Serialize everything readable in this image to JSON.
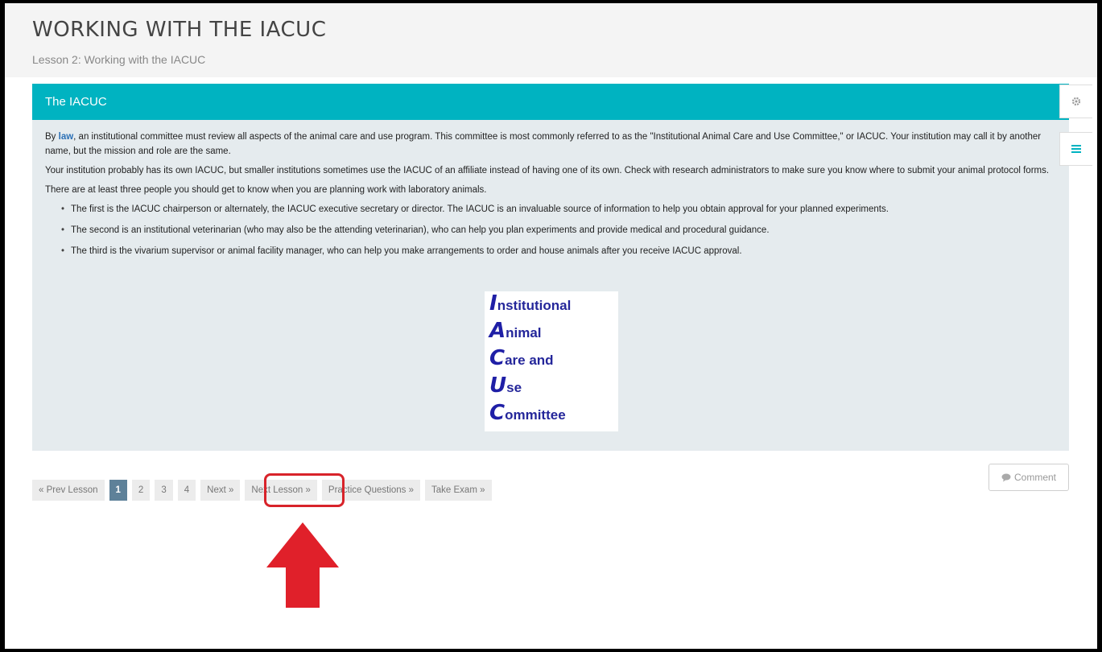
{
  "header": {
    "title": "WORKING WITH THE IACUC",
    "subtitle": "Lesson 2: Working with the IACUC"
  },
  "panel": {
    "title": "The IACUC",
    "paragraph1": {
      "prefix": "By ",
      "link": "law",
      "rest": ", an institutional committee must review all aspects of the animal care and use program. This committee is most commonly referred to as the \"Institutional Animal Care and Use Committee,\" or IACUC. Your institution may call it by another name, but the mission and role are the same."
    },
    "paragraph2": "Your institution probably has its own IACUC, but smaller institutions sometimes use the IACUC of an affiliate instead of having one of its own. Check with research administrators to make sure you know where to submit your animal protocol forms.",
    "paragraph3": "There are at least three people you should get to know when you are planning work with laboratory animals.",
    "bullets": [
      "The first is the IACUC chairperson or alternately, the IACUC executive secretary or director. The IACUC is an invaluable source of information to help you obtain approval for your planned experiments.",
      "The second is an institutional veterinarian (who may also be the attending veterinarian), who can help you plan experiments and provide medical and procedural guidance.",
      "The third is the vivarium supervisor or animal facility manager, who can help you make arrangements to order and house animals after you receive IACUC approval."
    ],
    "acronym": [
      {
        "cap": "I",
        "rest": "nstitutional"
      },
      {
        "cap": "A",
        "rest": "nimal"
      },
      {
        "cap": "C",
        "rest": "are and"
      },
      {
        "cap": "U",
        "rest": "se"
      },
      {
        "cap": "C",
        "rest": "ommittee"
      }
    ]
  },
  "sidebar_icons": [
    "gear-icon",
    "list-icon"
  ],
  "pagination": {
    "prev_lesson": "« Prev Lesson",
    "pages": [
      "1",
      "2",
      "3",
      "4"
    ],
    "active_page": "1",
    "next": "Next »",
    "next_lesson": "Next Lesson »",
    "practice": "Practice Questions »",
    "exam": "Take Exam »"
  },
  "comment_button": "Comment",
  "colors": {
    "header_band": "#00b3c1",
    "active_page": "#5e8199",
    "highlight": "#d8232a"
  }
}
